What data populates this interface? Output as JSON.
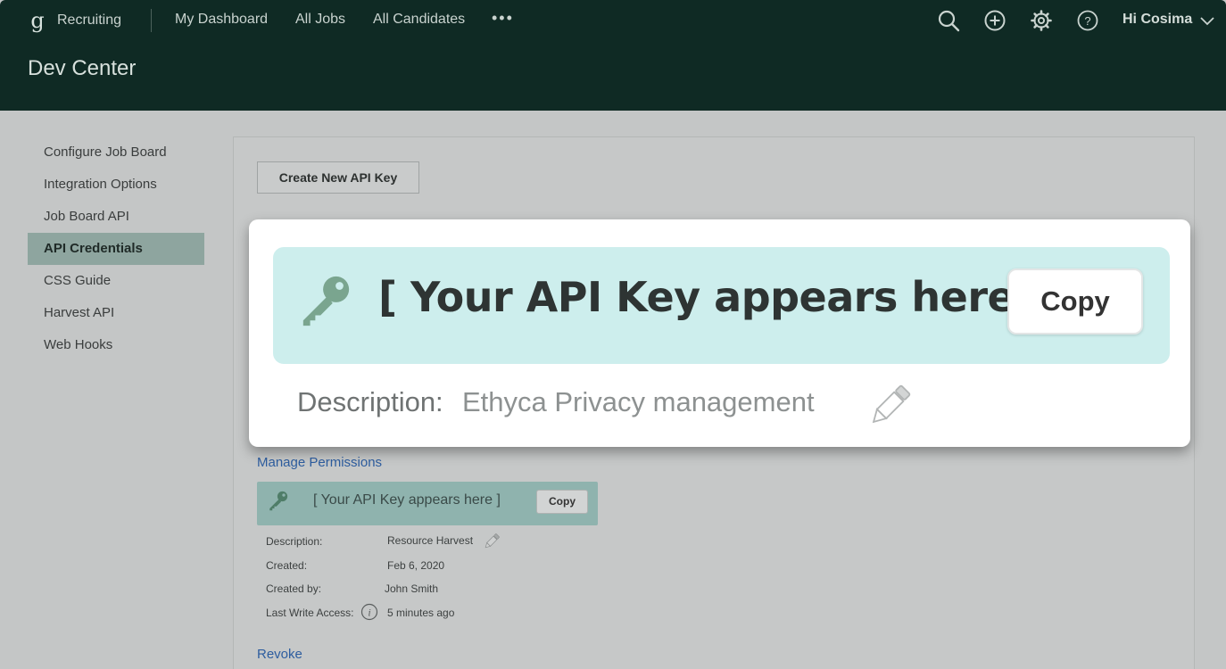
{
  "header": {
    "brand_logo": "g",
    "brand_name": "Recruiting",
    "nav": [
      "My Dashboard",
      "All Jobs",
      "All Candidates"
    ],
    "more": "•••",
    "greeting": "Hi Cosima",
    "page_title": "Dev Center",
    "icons": [
      "search-icon",
      "add-circle-icon",
      "gear-icon",
      "help-icon",
      "chevron-down-icon"
    ]
  },
  "sidebar": {
    "items": [
      {
        "label": "Configure Job Board"
      },
      {
        "label": "Integration Options"
      },
      {
        "label": "Job Board API"
      },
      {
        "label": "API Credentials",
        "active": true
      },
      {
        "label": "CSS Guide"
      },
      {
        "label": "Harvest API"
      },
      {
        "label": "Web Hooks"
      }
    ]
  },
  "main": {
    "create_button": "Create New API Key",
    "manage_permissions": "Manage Permissions",
    "revoke": "Revoke",
    "key_card": {
      "key_text": "[ Your API Key appears here ]",
      "copy_label": "Copy"
    },
    "details": {
      "description_label": "Description:",
      "description_value": "Resource Harvest",
      "created_label": "Created:",
      "created_value": "Feb 6, 2020",
      "created_by_label": "Created by:",
      "created_by_value": "John Smith",
      "last_write_label": "Last Write Access:",
      "last_write_value": "5 minutes ago"
    }
  },
  "zoom": {
    "key_text": "[ Your API Key appears here ]",
    "copy_label": "Copy",
    "description_label": "Description:",
    "description_value": "Ethyca Privacy management"
  },
  "colors": {
    "header_bg": "#0f2a24",
    "active_sidebar": "#8ea59f",
    "key_card": "#8fb3ae",
    "zoom_key_card": "#cdeeed",
    "link": "#2d5d9f",
    "key_icon": "#7aa58f"
  }
}
